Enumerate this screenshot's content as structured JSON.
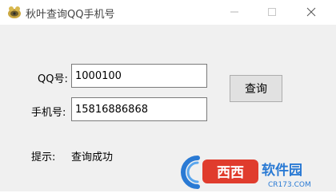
{
  "window": {
    "title": "秋叶查询QQ手机号"
  },
  "form": {
    "qq_label": "QQ号:",
    "qq_value": "1000100",
    "phone_label": "手机号:",
    "phone_value": "15816886868",
    "query_button": "查询",
    "tip_label": "提示:",
    "tip_value": "查询成功"
  },
  "watermark": {
    "brand": "西西软件园",
    "site": "CR173.COM"
  },
  "colors": {
    "background": "#f0f0f0",
    "button": "#e1e1e1",
    "watermark_blue": "#2a7ad4",
    "watermark_red": "#e03c2d"
  }
}
